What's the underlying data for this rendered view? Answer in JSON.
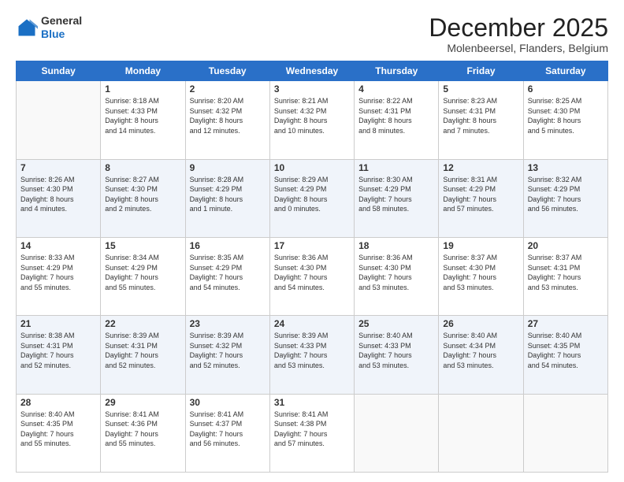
{
  "header": {
    "logo": {
      "line1": "General",
      "line2": "Blue"
    },
    "title": "December 2025",
    "subtitle": "Molenbeersel, Flanders, Belgium"
  },
  "days_of_week": [
    "Sunday",
    "Monday",
    "Tuesday",
    "Wednesday",
    "Thursday",
    "Friday",
    "Saturday"
  ],
  "weeks": [
    [
      {
        "day": "",
        "info": ""
      },
      {
        "day": "1",
        "info": "Sunrise: 8:18 AM\nSunset: 4:33 PM\nDaylight: 8 hours\nand 14 minutes."
      },
      {
        "day": "2",
        "info": "Sunrise: 8:20 AM\nSunset: 4:32 PM\nDaylight: 8 hours\nand 12 minutes."
      },
      {
        "day": "3",
        "info": "Sunrise: 8:21 AM\nSunset: 4:32 PM\nDaylight: 8 hours\nand 10 minutes."
      },
      {
        "day": "4",
        "info": "Sunrise: 8:22 AM\nSunset: 4:31 PM\nDaylight: 8 hours\nand 8 minutes."
      },
      {
        "day": "5",
        "info": "Sunrise: 8:23 AM\nSunset: 4:31 PM\nDaylight: 8 hours\nand 7 minutes."
      },
      {
        "day": "6",
        "info": "Sunrise: 8:25 AM\nSunset: 4:30 PM\nDaylight: 8 hours\nand 5 minutes."
      }
    ],
    [
      {
        "day": "7",
        "info": "Sunrise: 8:26 AM\nSunset: 4:30 PM\nDaylight: 8 hours\nand 4 minutes."
      },
      {
        "day": "8",
        "info": "Sunrise: 8:27 AM\nSunset: 4:30 PM\nDaylight: 8 hours\nand 2 minutes."
      },
      {
        "day": "9",
        "info": "Sunrise: 8:28 AM\nSunset: 4:29 PM\nDaylight: 8 hours\nand 1 minute."
      },
      {
        "day": "10",
        "info": "Sunrise: 8:29 AM\nSunset: 4:29 PM\nDaylight: 8 hours\nand 0 minutes."
      },
      {
        "day": "11",
        "info": "Sunrise: 8:30 AM\nSunset: 4:29 PM\nDaylight: 7 hours\nand 58 minutes."
      },
      {
        "day": "12",
        "info": "Sunrise: 8:31 AM\nSunset: 4:29 PM\nDaylight: 7 hours\nand 57 minutes."
      },
      {
        "day": "13",
        "info": "Sunrise: 8:32 AM\nSunset: 4:29 PM\nDaylight: 7 hours\nand 56 minutes."
      }
    ],
    [
      {
        "day": "14",
        "info": "Sunrise: 8:33 AM\nSunset: 4:29 PM\nDaylight: 7 hours\nand 55 minutes."
      },
      {
        "day": "15",
        "info": "Sunrise: 8:34 AM\nSunset: 4:29 PM\nDaylight: 7 hours\nand 55 minutes."
      },
      {
        "day": "16",
        "info": "Sunrise: 8:35 AM\nSunset: 4:29 PM\nDaylight: 7 hours\nand 54 minutes."
      },
      {
        "day": "17",
        "info": "Sunrise: 8:36 AM\nSunset: 4:30 PM\nDaylight: 7 hours\nand 54 minutes."
      },
      {
        "day": "18",
        "info": "Sunrise: 8:36 AM\nSunset: 4:30 PM\nDaylight: 7 hours\nand 53 minutes."
      },
      {
        "day": "19",
        "info": "Sunrise: 8:37 AM\nSunset: 4:30 PM\nDaylight: 7 hours\nand 53 minutes."
      },
      {
        "day": "20",
        "info": "Sunrise: 8:37 AM\nSunset: 4:31 PM\nDaylight: 7 hours\nand 53 minutes."
      }
    ],
    [
      {
        "day": "21",
        "info": "Sunrise: 8:38 AM\nSunset: 4:31 PM\nDaylight: 7 hours\nand 52 minutes."
      },
      {
        "day": "22",
        "info": "Sunrise: 8:39 AM\nSunset: 4:31 PM\nDaylight: 7 hours\nand 52 minutes."
      },
      {
        "day": "23",
        "info": "Sunrise: 8:39 AM\nSunset: 4:32 PM\nDaylight: 7 hours\nand 52 minutes."
      },
      {
        "day": "24",
        "info": "Sunrise: 8:39 AM\nSunset: 4:33 PM\nDaylight: 7 hours\nand 53 minutes."
      },
      {
        "day": "25",
        "info": "Sunrise: 8:40 AM\nSunset: 4:33 PM\nDaylight: 7 hours\nand 53 minutes."
      },
      {
        "day": "26",
        "info": "Sunrise: 8:40 AM\nSunset: 4:34 PM\nDaylight: 7 hours\nand 53 minutes."
      },
      {
        "day": "27",
        "info": "Sunrise: 8:40 AM\nSunset: 4:35 PM\nDaylight: 7 hours\nand 54 minutes."
      }
    ],
    [
      {
        "day": "28",
        "info": "Sunrise: 8:40 AM\nSunset: 4:35 PM\nDaylight: 7 hours\nand 55 minutes."
      },
      {
        "day": "29",
        "info": "Sunrise: 8:41 AM\nSunset: 4:36 PM\nDaylight: 7 hours\nand 55 minutes."
      },
      {
        "day": "30",
        "info": "Sunrise: 8:41 AM\nSunset: 4:37 PM\nDaylight: 7 hours\nand 56 minutes."
      },
      {
        "day": "31",
        "info": "Sunrise: 8:41 AM\nSunset: 4:38 PM\nDaylight: 7 hours\nand 57 minutes."
      },
      {
        "day": "",
        "info": ""
      },
      {
        "day": "",
        "info": ""
      },
      {
        "day": "",
        "info": ""
      }
    ]
  ]
}
